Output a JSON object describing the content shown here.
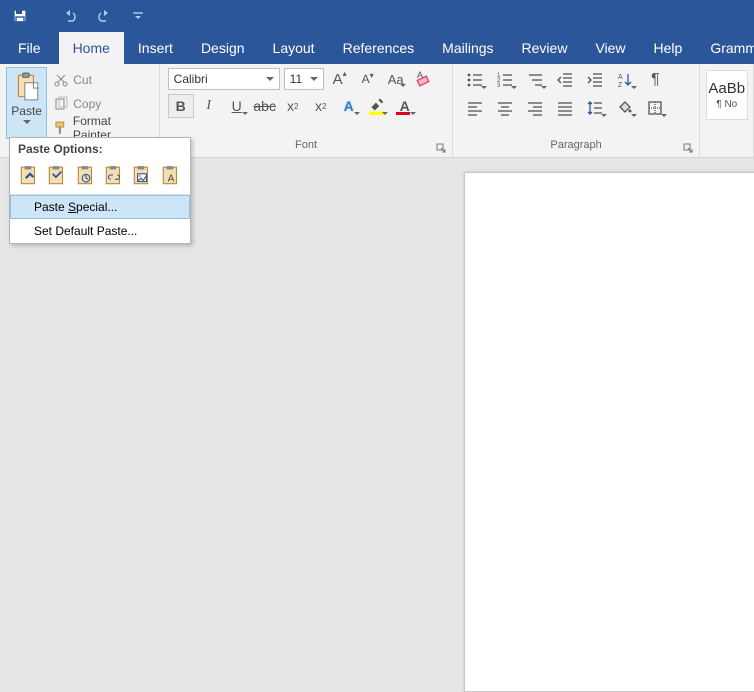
{
  "tabs": {
    "file": "File",
    "home": "Home",
    "insert": "Insert",
    "design": "Design",
    "layout": "Layout",
    "references": "References",
    "mailings": "Mailings",
    "review": "Review",
    "view": "View",
    "help": "Help",
    "grammarly": "Grammarly"
  },
  "clipboard": {
    "paste_label": "Paste",
    "cut": "Cut",
    "copy": "Copy",
    "format_painter": "Format Painter"
  },
  "font": {
    "name": "Calibri",
    "size": "11",
    "group_label": "Font"
  },
  "paragraph": {
    "group_label": "Paragraph"
  },
  "styles": {
    "preview": "AaBb",
    "caption": "¶ No"
  },
  "paste_menu": {
    "header": "Paste Options:",
    "paste_special": "Paste Special...",
    "set_default": "Set Default Paste..."
  }
}
